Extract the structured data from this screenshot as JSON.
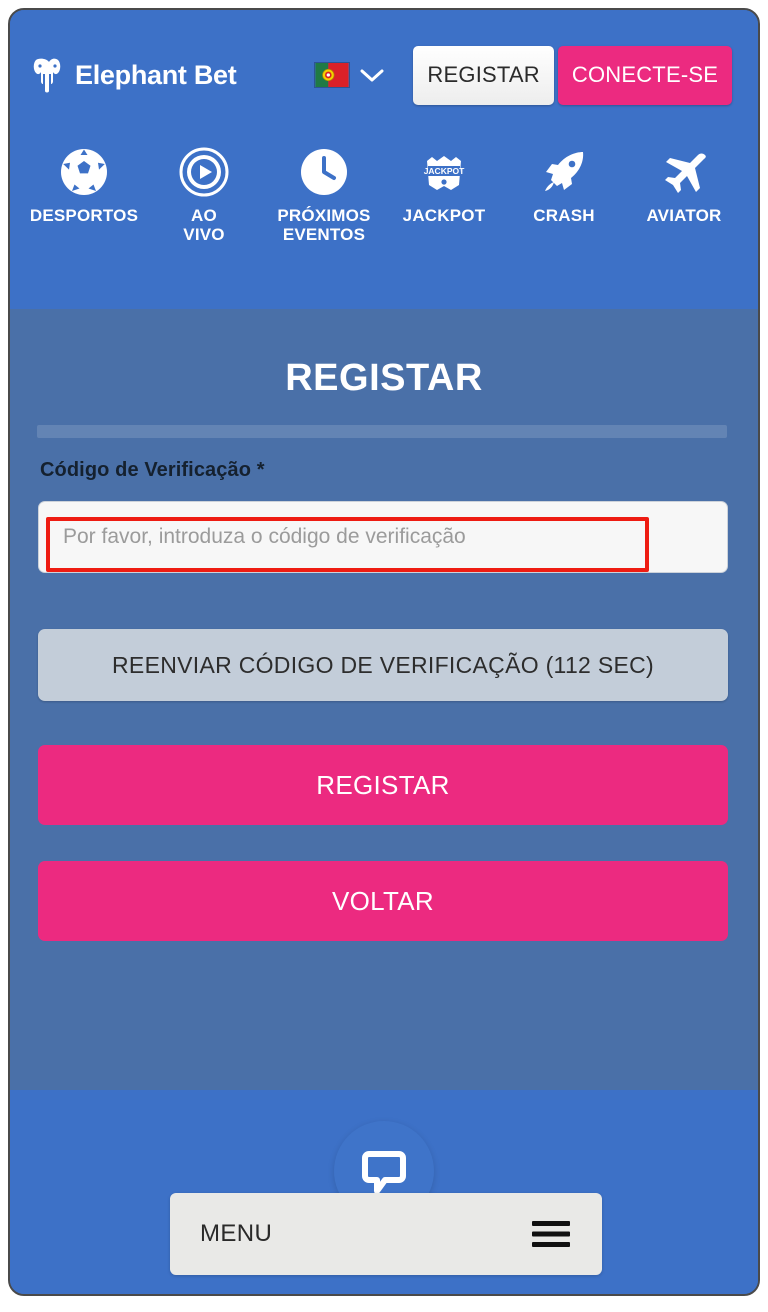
{
  "brand": {
    "name": "Elephant Bet",
    "logo_icon": "elephant-icon",
    "primary_blue": "#3d71c7",
    "panel_blue": "#4a70a8",
    "accent_pink": "#ec2a80"
  },
  "header": {
    "language": {
      "flag_icon": "portugal-flag-icon",
      "chevron_icon": "chevron-down-icon"
    },
    "register_label": "REGISTAR",
    "login_label": "CONECTE-SE"
  },
  "nav": {
    "items": [
      {
        "label": "DESPORTOS",
        "icon": "soccer-ball-icon"
      },
      {
        "label": "AO\nVIVO",
        "icon": "play-circle-icon"
      },
      {
        "label": "PRÓXIMOS\nEVENTOS",
        "icon": "clock-icon"
      },
      {
        "label": "JACKPOT",
        "icon": "jackpot-badge-icon"
      },
      {
        "label": "CRASH",
        "icon": "rocket-icon"
      },
      {
        "label": "AVIATOR",
        "icon": "airplane-icon"
      }
    ]
  },
  "form": {
    "title": "REGISTAR",
    "field_label": "Código de Verificação *",
    "code_value": "",
    "code_placeholder": "Por favor, introduza o código de verificação",
    "resend_label": "REENVIAR CÓDIGO DE VERIFICAÇÃO (112 SEC)",
    "resend_seconds": 112,
    "submit_label": "REGISTAR",
    "back_label": "VOLTAR",
    "annotation_color": "#ee1c12"
  },
  "footer": {
    "chat_icon": "chat-bubble-icon",
    "menu_label": "MENU",
    "menu_icon": "hamburger-menu-icon"
  }
}
